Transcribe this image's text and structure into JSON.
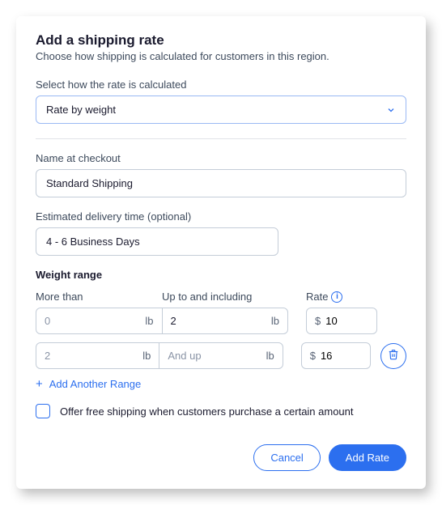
{
  "header": {
    "title": "Add a shipping rate",
    "subtitle": "Choose how shipping is calculated for customers in this region."
  },
  "rate_method": {
    "label": "Select how the rate is calculated",
    "value": "Rate by weight"
  },
  "name": {
    "label": "Name at checkout",
    "value": "Standard Shipping"
  },
  "delivery_time": {
    "label": "Estimated delivery time (optional)",
    "value": "4 - 6 Business Days"
  },
  "weight_range": {
    "section_title": "Weight range",
    "columns": {
      "more_than": "More than",
      "up_to": "Up to and including",
      "rate": "Rate"
    },
    "unit": "lb",
    "currency": "$",
    "and_up_placeholder": "And up",
    "rows": [
      {
        "from": "0",
        "to": "2",
        "rate": "10",
        "deletable": false
      },
      {
        "from": "2",
        "to": "",
        "rate": "16",
        "deletable": true
      }
    ],
    "add_another": "Add Another Range"
  },
  "free_shipping": {
    "label": "Offer free shipping when customers purchase a certain amount",
    "checked": false
  },
  "actions": {
    "cancel": "Cancel",
    "submit": "Add Rate"
  }
}
